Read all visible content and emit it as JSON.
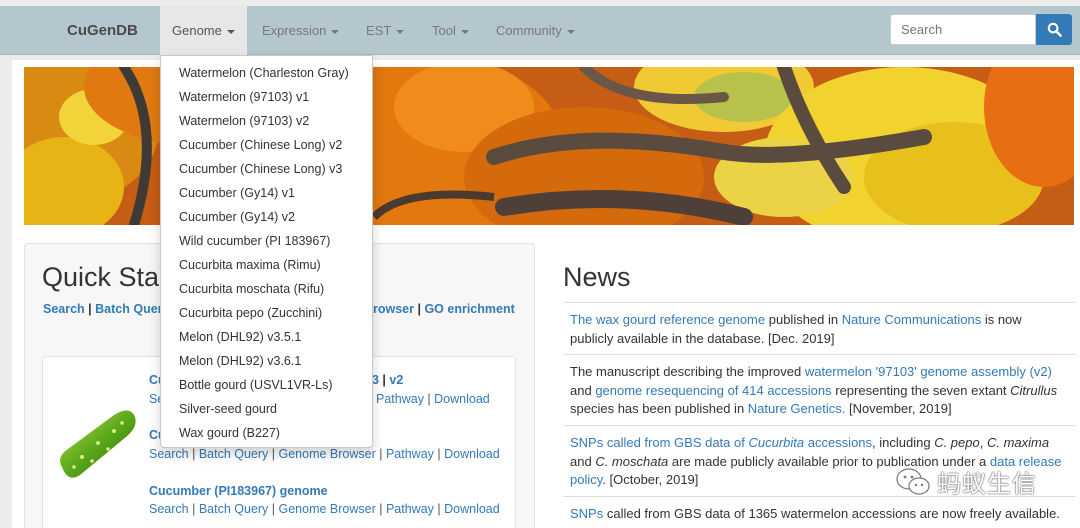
{
  "navbar": {
    "brand": "CuGenDB",
    "items": [
      {
        "label": "Genome"
      },
      {
        "label": "Expression"
      },
      {
        "label": "EST"
      },
      {
        "label": "Tool"
      },
      {
        "label": "Community"
      }
    ],
    "search_placeholder": "Search"
  },
  "dropdown": {
    "items": [
      "Watermelon (Charleston Gray)",
      "Watermelon (97103) v1",
      "Watermelon (97103) v2",
      "Cucumber (Chinese Long) v2",
      "Cucumber (Chinese Long) v3",
      "Cucumber (Gy14) v1",
      "Cucumber (Gy14) v2",
      "Wild cucumber (PI 183967)",
      "Cucurbita maxima (Rimu)",
      "Cucurbita moschata (Rifu)",
      "Cucurbita pepo (Zucchini)",
      "Melon (DHL92) v3.5.1",
      "Melon (DHL92) v3.6.1",
      "Bottle gourd (USVL1VR-Ls)",
      "Silver-seed gourd",
      "Wax gourd (B227)"
    ]
  },
  "quick_start": {
    "title": "Quick Sta",
    "links": {
      "search": "Search",
      "batch": "Batch Quer",
      "browser": "rowser",
      "go": "GO enrichment"
    },
    "genomes": [
      {
        "title_prefix": "Cu",
        "title_suffix": "3",
        "v2": "v2",
        "links_visible": [
          "Se",
          "Pathway",
          "Download"
        ]
      },
      {
        "title_prefix": "Cu",
        "links": [
          "Search",
          "Batch Query",
          "Genome Browser",
          "Pathway",
          "Download"
        ]
      },
      {
        "title": "Cucumber (PI183967) genome",
        "links": [
          "Search",
          "Batch Query",
          "Genome Browser",
          "Pathway",
          "Download"
        ]
      }
    ]
  },
  "news": {
    "title": "News",
    "items": [
      {
        "a1": "The wax gourd reference genome",
        "t1": " published in ",
        "a2": "Nature Communications",
        "t2": " is now publicly available in the database. [Dec. 2019]"
      },
      {
        "t1": "The manuscript describing the improved ",
        "a1": "watermelon '97103' genome assembly (v2)",
        "t2": " and ",
        "a2": "genome resequencing of 414 accessions",
        "t3": " representing the seven extant ",
        "i1": "Citrullus",
        "t4": " species has been published in ",
        "a3": "Nature Genetics.",
        "t5": " [November, 2019]"
      },
      {
        "a1": "SNPs called from GBS data of ",
        "a1i": "Cucurbita",
        "a1b": " accessions",
        "t1": ", including ",
        "i1": "C. pepo",
        "t2": ", ",
        "i2": "C. maxima",
        "t3": " and ",
        "i3": "C. moschata",
        "t4": " are made publicly available prior to publication under a ",
        "a2": "data release policy",
        "t5": ". [October, 2019]"
      },
      {
        "a1": "SNPs",
        "t1": " called from GBS data of 1365 watermelon accessions are now freely available."
      }
    ]
  },
  "watermark": {
    "text": "蚂蚁生信"
  }
}
